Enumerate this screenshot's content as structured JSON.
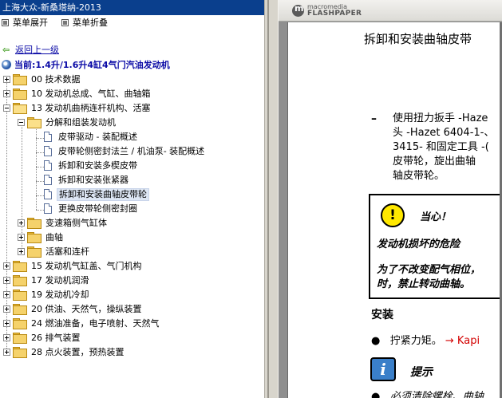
{
  "window": {
    "title": "上海大众-新桑塔纳-2013"
  },
  "menu": {
    "expand": "菜单展开",
    "collapse": "菜单折叠"
  },
  "back": {
    "label": "返回上一级"
  },
  "current": {
    "label": "当前:1.4升/1.6升4缸4气门汽油发动机"
  },
  "tree": {
    "items": [
      {
        "label": "00 技术数据"
      },
      {
        "label": "10 发动机总成、气缸、曲轴箱"
      },
      {
        "label": "13 发动机曲柄连杆机构、活塞"
      },
      {
        "label": "分解和组装发动机"
      },
      {
        "label": "皮带驱动 - 装配概述"
      },
      {
        "label": "皮带轮侧密封法兰 / 机油泵- 装配概述"
      },
      {
        "label": "拆卸和安装多楔皮带"
      },
      {
        "label": "拆卸和安装张紧器"
      },
      {
        "label": "拆卸和安装曲轴皮带轮"
      },
      {
        "label": "更换皮带轮侧密封圈"
      },
      {
        "label": "变速箱侧气缸体"
      },
      {
        "label": "曲轴"
      },
      {
        "label": "活塞和连杆"
      },
      {
        "label": "15 发动机气缸盖、气门机构"
      },
      {
        "label": "17 发动机润滑"
      },
      {
        "label": "19 发动机冷却"
      },
      {
        "label": "20 供油、天然气，操纵装置"
      },
      {
        "label": "24 燃油准备，电子喷射、天然气"
      },
      {
        "label": "26 排气装置"
      },
      {
        "label": "28 点火装置，预热装置"
      }
    ]
  },
  "viewer": {
    "brand_top": "macromedia",
    "brand_bottom": "FLASHPAPER",
    "page_title": "拆卸和安装曲轴皮带",
    "dash": "–",
    "body_lines": [
      "使用扭力扳手 -Haze",
      "头 -Hazet 6404-1-、",
      "3415- 和固定工具 -(",
      "皮带轮，旋出曲轴",
      "轴皮带轮。"
    ],
    "warning_icon": "!",
    "warning_title": "当心！",
    "warning_lines": [
      "发动机损坏的危险",
      "为了不改变配气相位，",
      "时，禁止转动曲轴。"
    ],
    "install_heading": "安装",
    "bullet_char": "●",
    "tighten_text": "拧紧力矩。",
    "tighten_link": "→ Kapi",
    "info_icon": "i",
    "info_title": "提示",
    "bullet2_text": "必须清除螺栓、曲轴"
  }
}
